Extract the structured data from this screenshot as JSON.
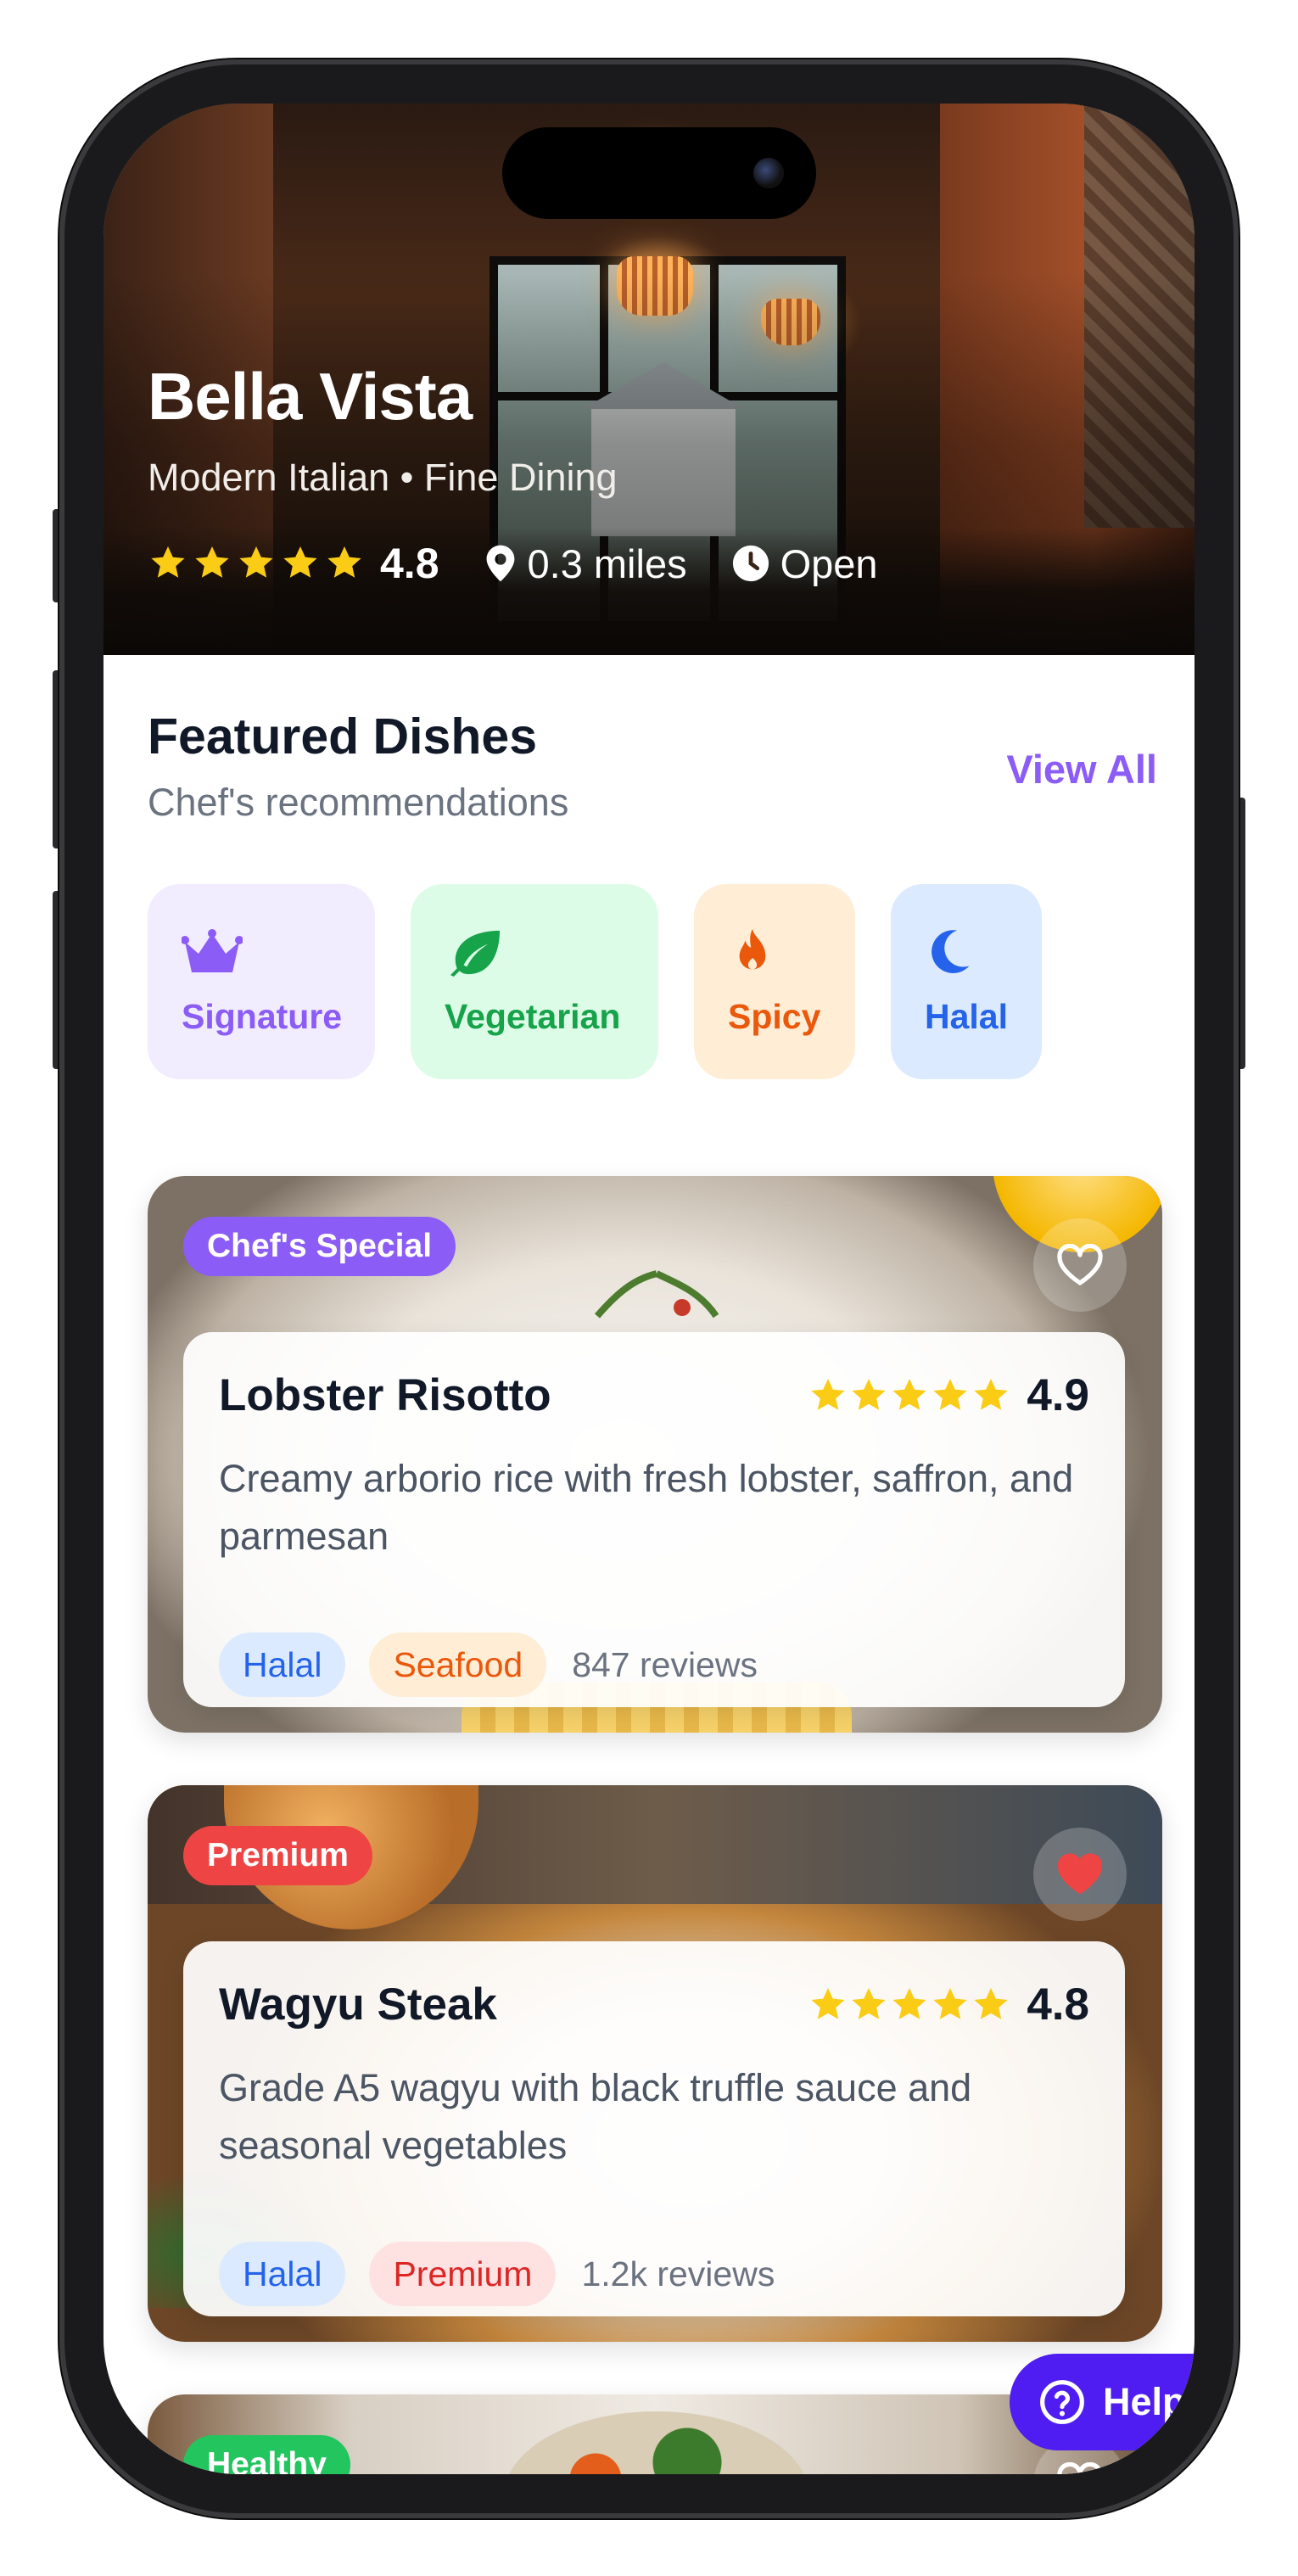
{
  "restaurant": {
    "name": "Bella Vista",
    "subtitle": "Modern Italian • Fine Dining",
    "rating": "4.8",
    "distance": "0.3 miles",
    "status": "Open",
    "stars": 5
  },
  "featured": {
    "title": "Featured Dishes",
    "subtitle": "Chef's recommendations",
    "view_all": "View All"
  },
  "categories": [
    {
      "label": "Signature",
      "icon": "crown-icon",
      "color": "#8b5cf6"
    },
    {
      "label": "Vegetarian",
      "icon": "leaf-icon",
      "color": "#16a34a"
    },
    {
      "label": "Spicy",
      "icon": "fire-icon",
      "color": "#ea580c"
    },
    {
      "label": "Halal",
      "icon": "moon-icon",
      "color": "#2563eb"
    }
  ],
  "dishes": [
    {
      "badge": "Chef's Special",
      "name": "Lobster Risotto",
      "rating": "4.9",
      "description": "Creamy arborio rice with fresh lobster, saffron, and parmesan",
      "tags": [
        "Halal",
        "Seafood"
      ],
      "reviews": "847 reviews",
      "favorited": false
    },
    {
      "badge": "Premium",
      "name": "Wagyu Steak",
      "rating": "4.8",
      "description": "Grade A5 wagyu with black truffle sauce and seasonal vegetables",
      "tags": [
        "Halal",
        "Premium"
      ],
      "reviews": "1.2k reviews",
      "favorited": true
    },
    {
      "badge": "Healthy",
      "favorited": false
    }
  ],
  "help": {
    "label": "Help"
  },
  "colors": {
    "accent": "#8b5cf6",
    "help": "#4f1df2",
    "star": "#facc15",
    "heart": "#ef4444"
  }
}
